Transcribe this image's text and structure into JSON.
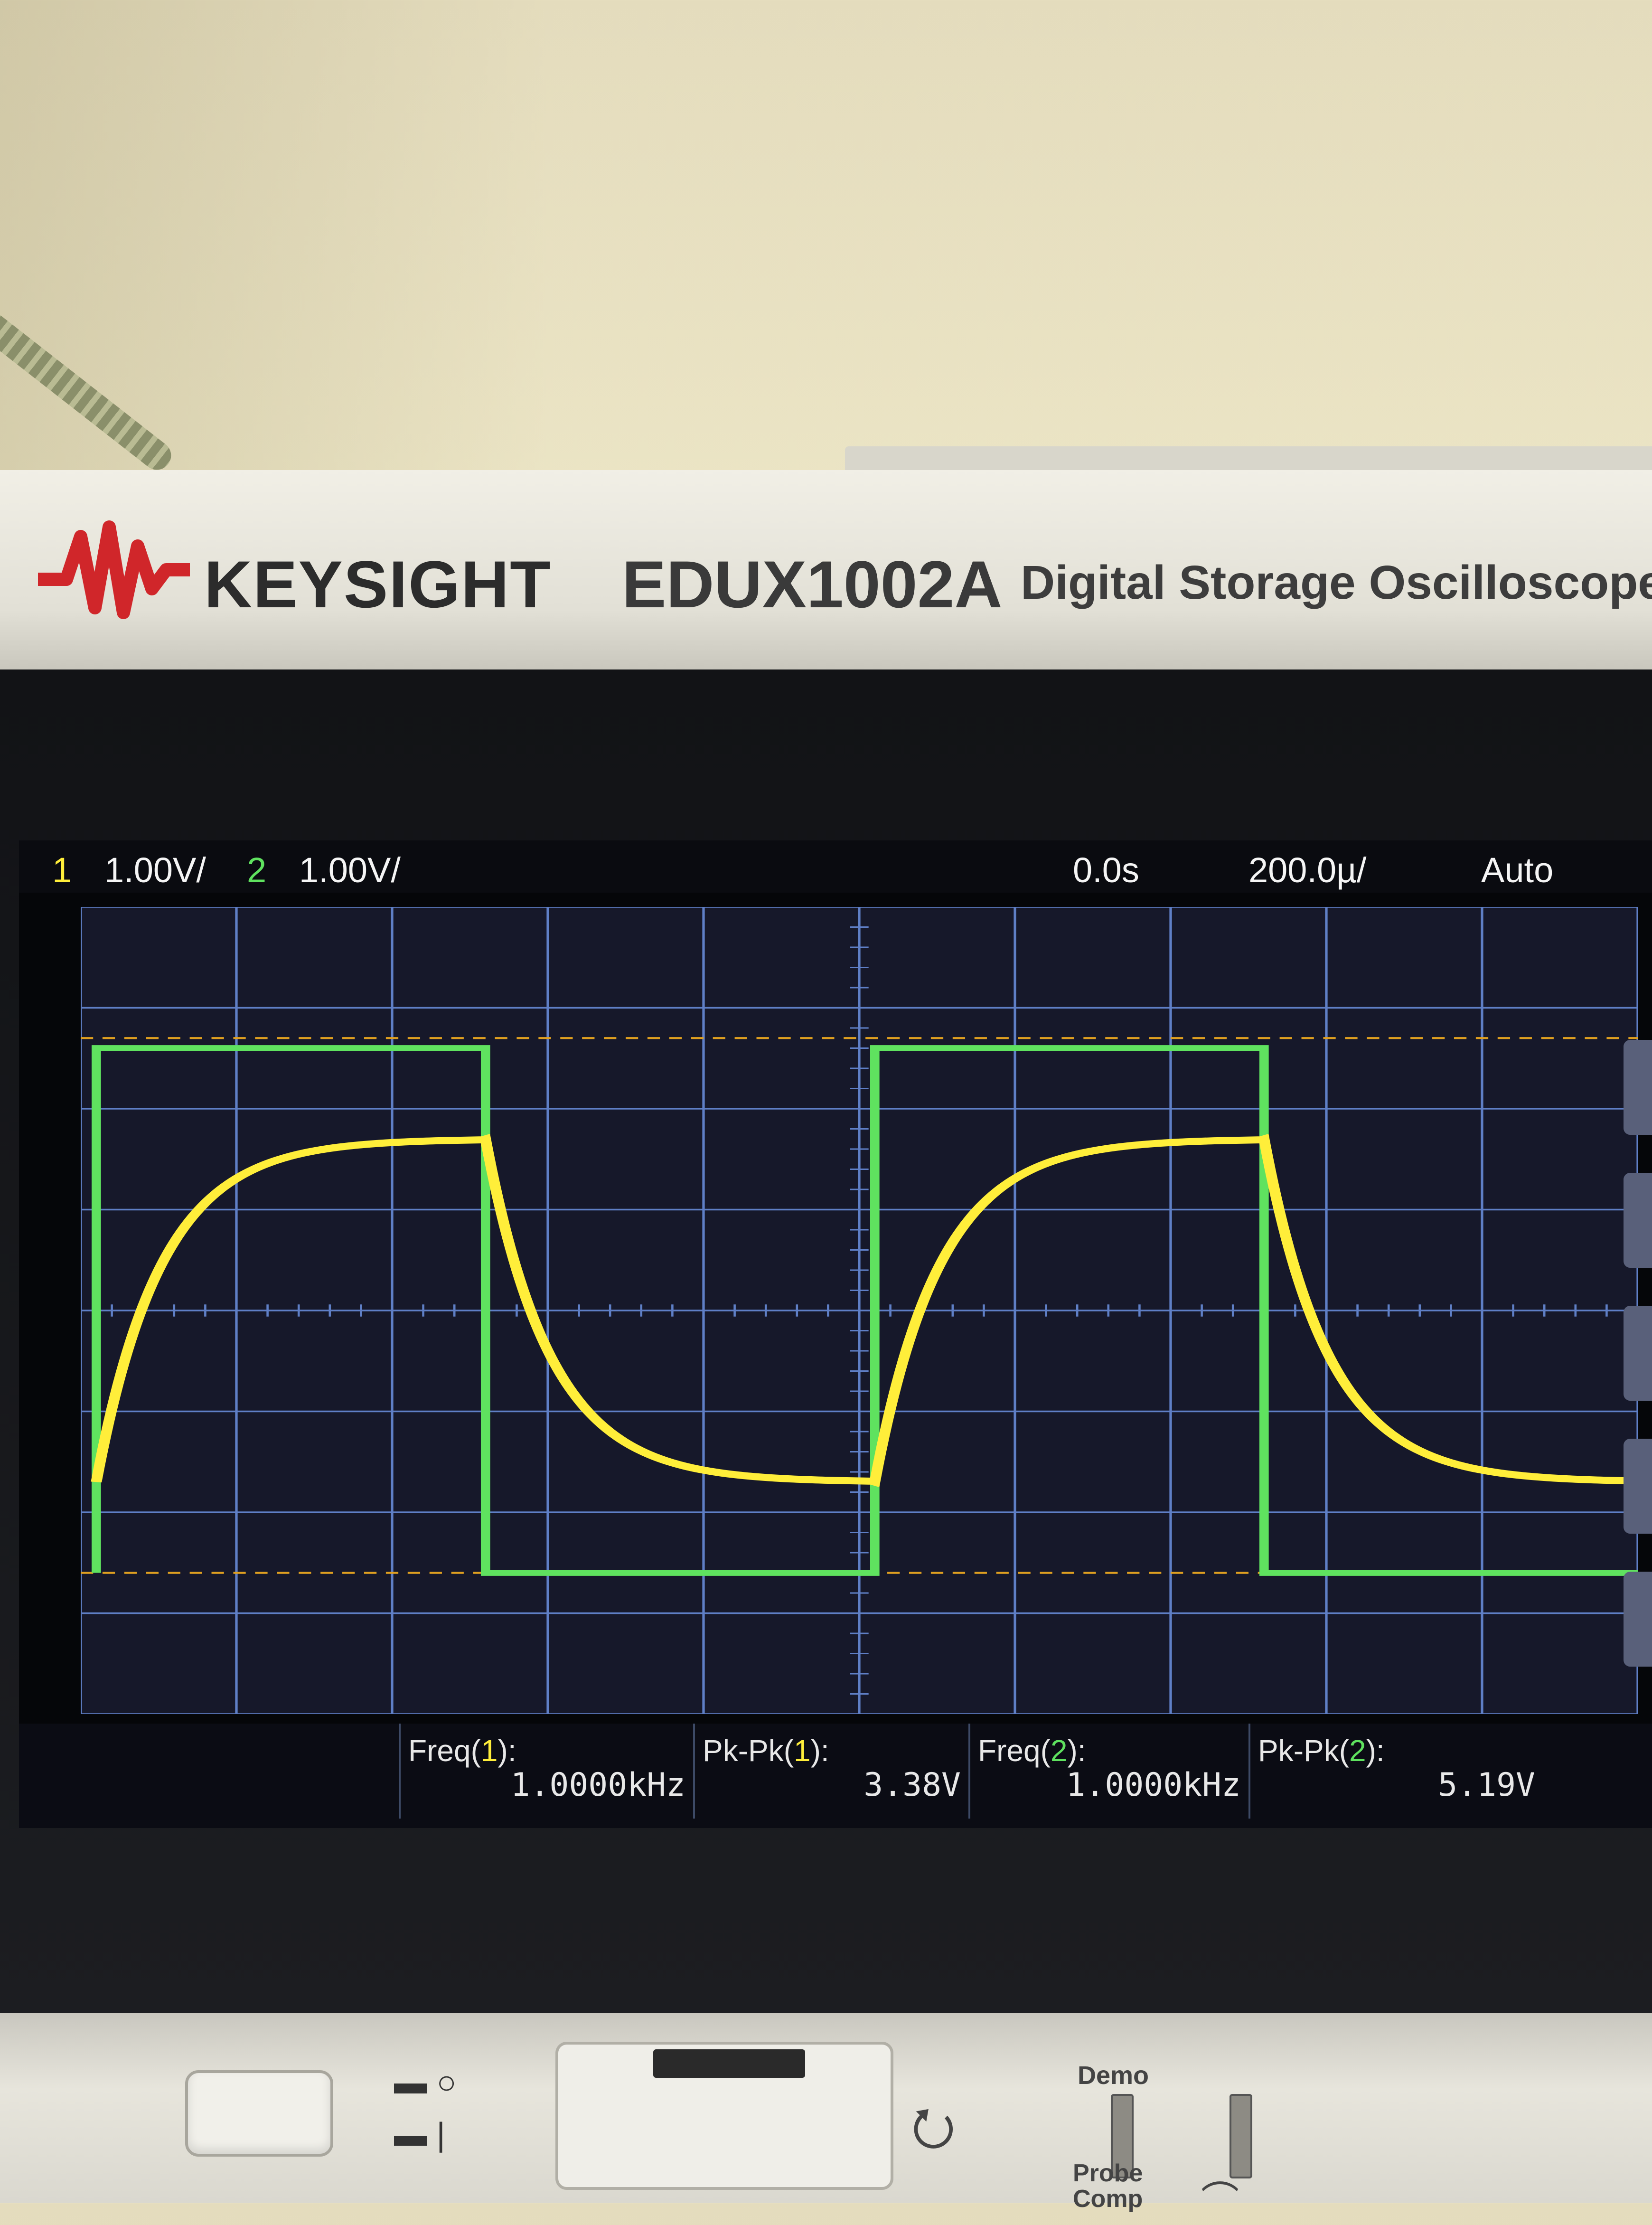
{
  "brand": {
    "logo": "keysight-wave-logo",
    "name": "KEYSIGHT",
    "model": "EDUX1002A",
    "description": "Digital Storage Oscilloscope"
  },
  "status": {
    "ch1_num": "1",
    "ch1_scale": "1.00V/",
    "ch2_num": "2",
    "ch2_scale": "1.00V/",
    "time_offset": "0.0s",
    "time_scale": "200.0µ/",
    "trigger_mode": "Auto"
  },
  "measurements": [
    {
      "label_pre": "Freq(",
      "ch": "1",
      "label_post": "):",
      "value": "1.0000kHz"
    },
    {
      "label_pre": "Pk-Pk(",
      "ch": "1",
      "label_post": "):",
      "value": "3.38V"
    },
    {
      "label_pre": "Freq(",
      "ch": "2",
      "label_post": "):",
      "value": "1.0000kHz"
    },
    {
      "label_pre": "Pk-Pk(",
      "ch": "2",
      "label_post": "):",
      "value": "5.19V"
    }
  ],
  "waveforms": {
    "ch1_color": "#ffee3a",
    "ch2_color": "#5fe25f",
    "grid_color": "#5f7fc6",
    "ch1_shape": "rc-charge-square",
    "ch2_shape": "square",
    "period_divisions": 5,
    "horizontal_divisions": 10,
    "vertical_divisions": 8,
    "ch2_high_div": 2.6,
    "ch2_low_div": -2.6,
    "ch1_high_div": 1.7,
    "ch1_low_div": -1.7,
    "rise_start_div": 0.1
  },
  "front_panel": {
    "demo_label": "Demo",
    "probe_comp_label_1": "Probe",
    "probe_comp_label_2": "Comp",
    "usb_icon": "usb-icon",
    "power_icons": [
      "power-standby-icon",
      "power-on-icon"
    ]
  }
}
